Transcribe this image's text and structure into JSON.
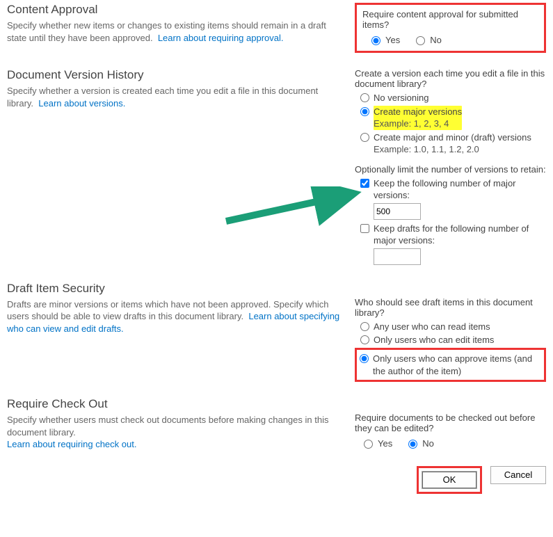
{
  "contentApproval": {
    "title": "Content Approval",
    "desc": "Specify whether new items or changes to existing items should remain in a draft state until they have been approved.",
    "link": "Learn about requiring approval.",
    "question": "Require content approval for submitted items?",
    "yes": "Yes",
    "no": "No"
  },
  "versionHistory": {
    "title": "Document Version History",
    "desc": "Specify whether a version is created each time you edit a file in this document library.",
    "link": "Learn about versions.",
    "question": "Create a version each time you edit a file in this document library?",
    "optNone": "No versioning",
    "optMajor": "Create major versions",
    "optMajorEx": "Example: 1, 2, 3, 4",
    "optMinor": "Create major and minor (draft) versions",
    "optMinorEx": "Example: 1.0, 1.1, 1.2, 2.0",
    "limitQ": "Optionally limit the number of versions to retain:",
    "keepMajor": "Keep the following number of major versions:",
    "keepMajorVal": "500",
    "keepDrafts": "Keep drafts for the following number of major versions:",
    "keepDraftsVal": ""
  },
  "draftSecurity": {
    "title": "Draft Item Security",
    "desc": "Drafts are minor versions or items which have not been approved. Specify which users should be able to view drafts in this document library.",
    "link": "Learn about specifying who can view and edit drafts.",
    "question": "Who should see draft items in this document library?",
    "optAny": "Any user who can read items",
    "optEdit": "Only users who can edit items",
    "optApprove": "Only users who can approve items (and the author of the item)"
  },
  "checkOut": {
    "title": "Require Check Out",
    "desc": "Specify whether users must check out documents before making changes in this document library.",
    "link": "Learn about requiring check out.",
    "question": "Require documents to be checked out before they can be edited?",
    "yes": "Yes",
    "no": "No"
  },
  "buttons": {
    "ok": "OK",
    "cancel": "Cancel"
  }
}
